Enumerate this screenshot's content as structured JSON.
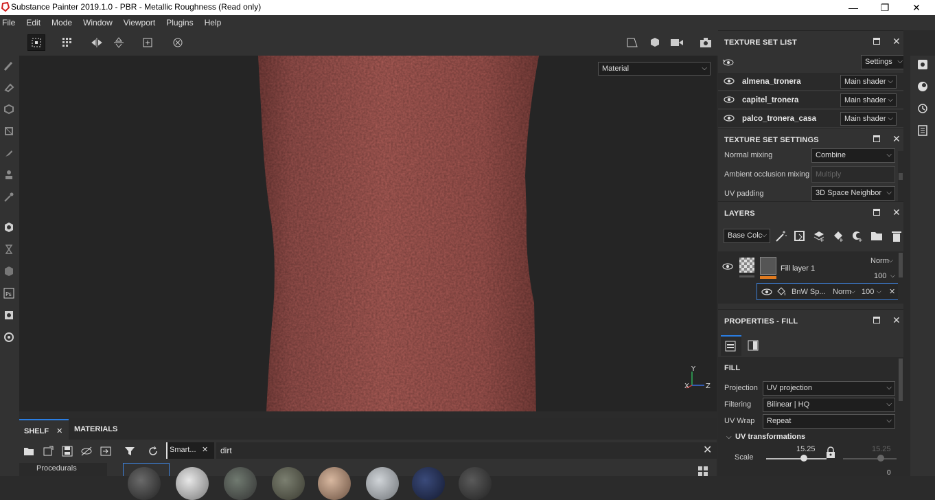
{
  "window": {
    "title": "Substance Painter 2019.1.0 - PBR - Metallic Roughness (Read only)",
    "minimize": "—",
    "maximize": "❐",
    "close": "✕"
  },
  "menu": [
    "File",
    "Edit",
    "Mode",
    "Window",
    "Viewport",
    "Plugins",
    "Help"
  ],
  "viewport": {
    "material_mode": "Material",
    "axis_y": "Y",
    "axis_x": "X",
    "axis_z": "Z",
    "mesh_color": "#a85a55"
  },
  "texture_set_list": {
    "title": "TEXTURE SET LIST",
    "settings_label": "Settings",
    "items": [
      {
        "name": "almena_tronera",
        "shader": "Main shader"
      },
      {
        "name": "capitel_tronera",
        "shader": "Main shader"
      },
      {
        "name": "palco_tronera_casa",
        "shader": "Main shader"
      }
    ]
  },
  "texture_set_settings": {
    "title": "TEXTURE SET SETTINGS",
    "normal_mixing_label": "Normal mixing",
    "normal_mixing_value": "Combine",
    "ao_mixing_label": "Ambient occlusion mixing",
    "ao_mixing_value": "Multiply",
    "uv_padding_label": "UV padding",
    "uv_padding_value": "3D Space Neighbor"
  },
  "layers": {
    "title": "LAYERS",
    "channel": "Base Colc",
    "fill_layer": {
      "name": "Fill layer 1",
      "blend": "Norm",
      "opacity": "100"
    },
    "mask": {
      "name": "BnW Sp...",
      "blend": "Norm",
      "opacity": "100"
    }
  },
  "properties": {
    "title": "PROPERTIES - FILL",
    "section": "FILL",
    "projection_label": "Projection",
    "projection_value": "UV projection",
    "filtering_label": "Filtering",
    "filtering_value": "Bilinear | HQ",
    "uvwrap_label": "UV Wrap",
    "uvwrap_value": "Repeat",
    "uv_transformations": "UV transformations",
    "scale_label": "Scale",
    "scale_value": "15.25",
    "scale_value2": "15.25",
    "below_value": "0"
  },
  "shelf": {
    "tab_shelf": "SHELF",
    "tab_materials": "MATERIALS",
    "filter_tag": "Smart...",
    "search_value": "dirt",
    "category": "Procedurals"
  },
  "colors": {
    "accent": "#2a7de1",
    "mask_outline": "#3d7fd6",
    "orange": "#e07a1f"
  }
}
